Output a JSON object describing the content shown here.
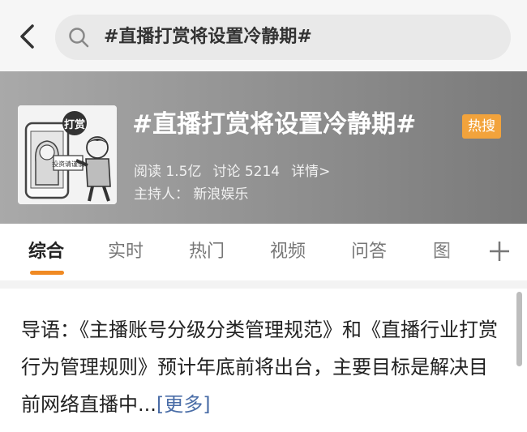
{
  "search": {
    "query": "#直播打赏将设置冷静期#"
  },
  "topic": {
    "title": "#直播打赏将设置冷静期#",
    "badge": "热搜",
    "reads": "阅读 1.5亿",
    "discussions": "讨论 5214",
    "details_link": "详情>",
    "host": "主持人：  新浪娱乐",
    "image_caption": "打赏",
    "image_label": "投资请谨慎"
  },
  "tabs": [
    {
      "label": "综合",
      "active": true
    },
    {
      "label": "实时"
    },
    {
      "label": "热门"
    },
    {
      "label": "视频"
    },
    {
      "label": "问答"
    },
    {
      "label": "图"
    }
  ],
  "intro": {
    "text": "导语：《主播账号分级分类管理规范》和《直播行业打赏行为管理规则》预计年底前将出台，主要目标是解决目前网络直播中...",
    "more": "[更多]"
  },
  "colors": {
    "accent": "#f08a23",
    "badge": "#f2a33c",
    "link": "#4a6da7"
  },
  "icons": {
    "back": "chevron-left-icon",
    "search": "search-icon",
    "add": "plus-icon"
  }
}
